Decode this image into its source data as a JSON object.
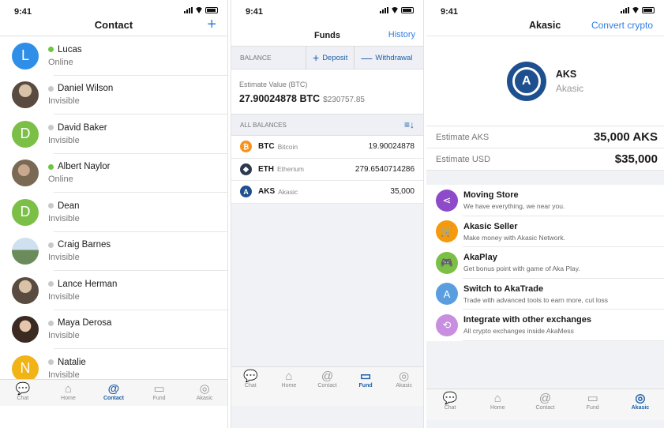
{
  "status_time": "9:41",
  "tabs": [
    {
      "label": "Chat",
      "icon": "chat-icon",
      "glyph": "💬"
    },
    {
      "label": "Home",
      "icon": "home-icon",
      "glyph": "⌂"
    },
    {
      "label": "Contact",
      "icon": "contact-icon",
      "glyph": "@"
    },
    {
      "label": "Fund",
      "icon": "wallet-icon",
      "glyph": "▭"
    },
    {
      "label": "Akasic",
      "icon": "akasic-icon",
      "glyph": "◎"
    }
  ],
  "contact_screen": {
    "title": "Contact",
    "add_label": "+",
    "contacts": [
      {
        "name": "Lucas",
        "status": "Online",
        "online": true,
        "initial": "L",
        "avatar_color": "#2f8fe8"
      },
      {
        "name": "Daniel Wilson",
        "status": "Invisible",
        "online": false,
        "initial": "",
        "avatar_color": "photo"
      },
      {
        "name": "David Baker",
        "status": "Invisible",
        "online": false,
        "initial": "D",
        "avatar_color": "#7cbf46"
      },
      {
        "name": "Albert Naylor",
        "status": "Online",
        "online": true,
        "initial": "",
        "avatar_color": "photo2"
      },
      {
        "name": "Dean",
        "status": "Invisible",
        "online": false,
        "initial": "D",
        "avatar_color": "#7cbf46"
      },
      {
        "name": "Craig Barnes",
        "status": "Invisible",
        "online": false,
        "initial": "",
        "avatar_color": "photo3"
      },
      {
        "name": "Lance Herman",
        "status": "Invisible",
        "online": false,
        "initial": "",
        "avatar_color": "photo"
      },
      {
        "name": "Maya Derosa",
        "status": "Invisible",
        "online": false,
        "initial": "",
        "avatar_color": "photo4"
      },
      {
        "name": "Natalie",
        "status": "Invisible",
        "online": false,
        "initial": "N",
        "avatar_color": "#f2b316"
      }
    ]
  },
  "funds_screen": {
    "title": "Funds",
    "history_label": "History",
    "balance_label": "BALANCE",
    "deposit_label": "Deposit",
    "withdrawal_label": "Withdrawal",
    "estimate_label": "Estimate Value (BTC)",
    "estimate_btc": "27.90024878 BTC",
    "estimate_usd": "$230757.85",
    "all_balances_label": "ALL BALANCES",
    "coins": [
      {
        "symbol": "BTC",
        "name": "Bitcoin",
        "amount": "19.90024878",
        "color": "#f7931a",
        "glyph": "₿"
      },
      {
        "symbol": "ETH",
        "name": "Etherium",
        "amount": "279.6540714286",
        "color": "#2c3a4f",
        "glyph": "◆"
      },
      {
        "symbol": "AKS",
        "name": "Akasic",
        "amount": "35,000",
        "color": "#1e4f8f",
        "glyph": "A"
      }
    ]
  },
  "akasic_screen": {
    "title": "Akasic",
    "convert_label": "Convert crypto",
    "coin_symbol": "AKS",
    "coin_name": "Akasic",
    "estimate_aks_label": "Estimate AKS",
    "estimate_aks_value": "35,000 AKS",
    "estimate_usd_label": "Estimate USD",
    "estimate_usd_value": "$35,000",
    "features": [
      {
        "title": "Moving Store",
        "subtitle": "We have everything, we near you.",
        "color": "#8d4bc9",
        "icon": "share-icon",
        "glyph": "⋖"
      },
      {
        "title": "Akasic Seller",
        "subtitle": "Make money with Akasic Network.",
        "color": "#f59a0c",
        "icon": "cart-icon",
        "glyph": "🛒"
      },
      {
        "title": "AkaPlay",
        "subtitle": "Get bonus point with game of Aka Play.",
        "color": "#7cbf46",
        "icon": "gamepad-icon",
        "glyph": "🎮"
      },
      {
        "title": "Switch to AkaTrade",
        "subtitle": "Trade with advanced tools to earn more, cut loss",
        "color": "#5b9ee0",
        "icon": "akatrade-icon",
        "glyph": "A"
      },
      {
        "title": "Integrate with other exchanges",
        "subtitle": "All crypto exchanges inside AkaMess",
        "color": "#c88ee0",
        "icon": "exchange-icon",
        "glyph": "⟲"
      }
    ]
  }
}
